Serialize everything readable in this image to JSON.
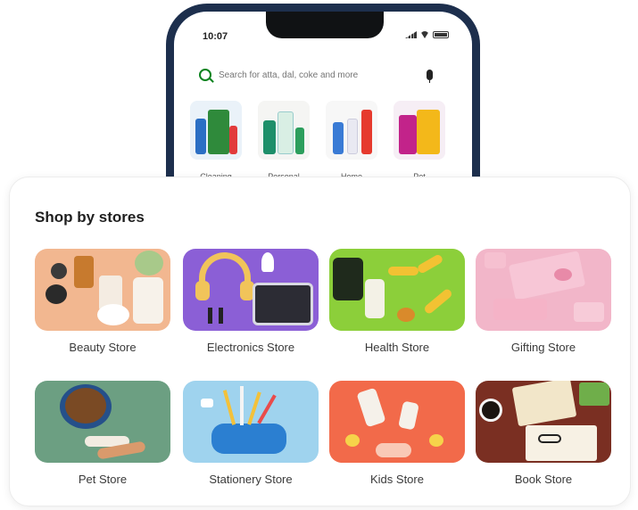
{
  "status_bar": {
    "time": "10:07"
  },
  "search": {
    "placeholder": "Search for atta, dal, coke and more"
  },
  "categories": [
    {
      "label": "Cleaning"
    },
    {
      "label": "Personal"
    },
    {
      "label": "Home"
    },
    {
      "label": "Pet"
    }
  ],
  "stores_section": {
    "title": "Shop by stores",
    "stores": [
      {
        "label": "Beauty Store"
      },
      {
        "label": "Electronics Store"
      },
      {
        "label": "Health Store"
      },
      {
        "label": "Gifting Store"
      },
      {
        "label": "Pet Store"
      },
      {
        "label": "Stationery Store"
      },
      {
        "label": "Kids Store"
      },
      {
        "label": "Book Store"
      }
    ]
  },
  "colors": {
    "phone_frame": "#1d2f4d",
    "accent_green": "#0c831f",
    "card_border": "#ececec"
  },
  "icons": [
    "search-icon",
    "microphone-icon",
    "signal-icon",
    "wifi-icon",
    "battery-icon"
  ]
}
